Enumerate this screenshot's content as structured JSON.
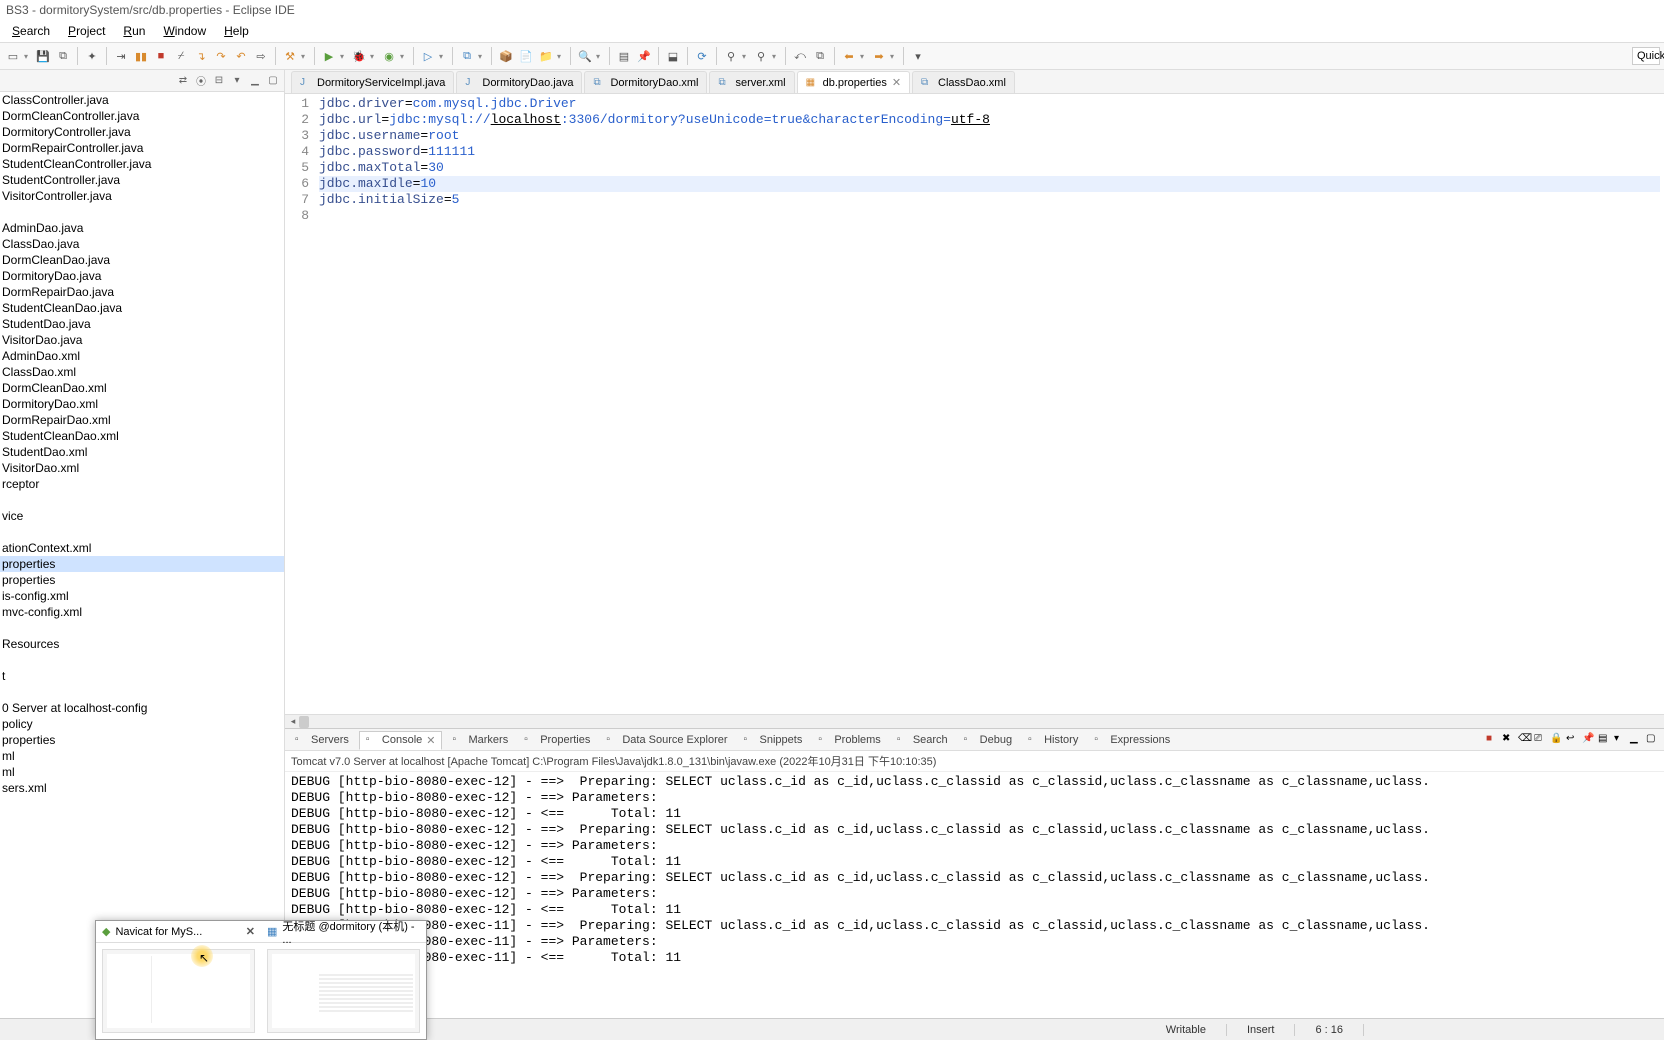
{
  "window": {
    "title": "BS3 - dormitorySystem/src/db.properties - Eclipse IDE"
  },
  "menu": [
    "Search",
    "Project",
    "Run",
    "Window",
    "Help"
  ],
  "quick": "Quick",
  "tree": {
    "items": [
      "ClassController.java",
      "DormCleanController.java",
      "DormitoryController.java",
      "DormRepairController.java",
      "StudentCleanController.java",
      "StudentController.java",
      "VisitorController.java",
      "",
      "AdminDao.java",
      "ClassDao.java",
      "DormCleanDao.java",
      "DormitoryDao.java",
      "DormRepairDao.java",
      "StudentCleanDao.java",
      "StudentDao.java",
      "VisitorDao.java",
      "AdminDao.xml",
      "ClassDao.xml",
      "DormCleanDao.xml",
      "DormitoryDao.xml",
      "DormRepairDao.xml",
      "StudentCleanDao.xml",
      "StudentDao.xml",
      "VisitorDao.xml",
      "rceptor",
      "",
      "vice",
      "",
      "ationContext.xml",
      "properties",
      "properties",
      "is-config.xml",
      "mvc-config.xml",
      "",
      "Resources",
      "",
      "t",
      "",
      "0 Server at localhost-config",
      "policy",
      "properties",
      "ml",
      "ml",
      "sers.xml"
    ],
    "selected": 29
  },
  "tabs": [
    {
      "label": "DormitoryServiceImpl.java",
      "kind": "java"
    },
    {
      "label": "DormitoryDao.java",
      "kind": "java"
    },
    {
      "label": "DormitoryDao.xml",
      "kind": "xml"
    },
    {
      "label": "server.xml",
      "kind": "xml"
    },
    {
      "label": "db.properties",
      "kind": "props",
      "active": true,
      "closeable": true
    },
    {
      "label": "ClassDao.xml",
      "kind": "xml"
    }
  ],
  "editor": {
    "highlight_line": 6,
    "lines": [
      {
        "n": 1,
        "tokens": [
          [
            "kw-key",
            "jdbc.driver"
          ],
          [
            "kw-plain",
            "="
          ],
          [
            "kw-val",
            "com.mysql.jdbc.Driver"
          ]
        ]
      },
      {
        "n": 2,
        "tokens": [
          [
            "kw-key",
            "jdbc.url"
          ],
          [
            "kw-plain",
            "="
          ],
          [
            "kw-val",
            "jdbc:mysql://"
          ],
          [
            "kw-host",
            "localhost"
          ],
          [
            "kw-val",
            ":3306/dormitory?useUnicode=true&characterEncoding="
          ],
          [
            "kw-enc",
            "utf-8"
          ]
        ]
      },
      {
        "n": 3,
        "tokens": [
          [
            "kw-key",
            "jdbc.username"
          ],
          [
            "kw-plain",
            "="
          ],
          [
            "kw-val",
            "root"
          ]
        ]
      },
      {
        "n": 4,
        "tokens": [
          [
            "kw-key",
            "jdbc.password"
          ],
          [
            "kw-plain",
            "="
          ],
          [
            "kw-val",
            "111111"
          ]
        ]
      },
      {
        "n": 5,
        "tokens": [
          [
            "kw-key",
            "jdbc.maxTotal"
          ],
          [
            "kw-plain",
            "="
          ],
          [
            "kw-val",
            "30"
          ]
        ]
      },
      {
        "n": 6,
        "tokens": [
          [
            "kw-key",
            "jdbc.maxIdle"
          ],
          [
            "kw-plain",
            "="
          ],
          [
            "kw-val",
            "10"
          ]
        ]
      },
      {
        "n": 7,
        "tokens": [
          [
            "kw-key",
            "jdbc.initialSize"
          ],
          [
            "kw-plain",
            "="
          ],
          [
            "kw-val",
            "5"
          ]
        ]
      },
      {
        "n": 8,
        "tokens": []
      }
    ]
  },
  "bottom": {
    "tabs": [
      "Servers",
      "Console",
      "Markers",
      "Properties",
      "Data Source Explorer",
      "Snippets",
      "Problems",
      "Search",
      "Debug",
      "History",
      "Expressions"
    ],
    "active": 1,
    "header": "Tomcat v7.0 Server at localhost [Apache Tomcat] C:\\Program Files\\Java\\jdk1.8.0_131\\bin\\javaw.exe (2022年10月31日 下午10:10:35)",
    "lines": [
      "DEBUG [http-bio-8080-exec-12] - ==>  Preparing: SELECT uclass.c_id as c_id,uclass.c_classid as c_classid,uclass.c_classname as c_classname,uclass.",
      "DEBUG [http-bio-8080-exec-12] - ==> Parameters: ",
      "DEBUG [http-bio-8080-exec-12] - <==      Total: 11",
      "DEBUG [http-bio-8080-exec-12] - ==>  Preparing: SELECT uclass.c_id as c_id,uclass.c_classid as c_classid,uclass.c_classname as c_classname,uclass.",
      "DEBUG [http-bio-8080-exec-12] - ==> Parameters: ",
      "DEBUG [http-bio-8080-exec-12] - <==      Total: 11",
      "DEBUG [http-bio-8080-exec-12] - ==>  Preparing: SELECT uclass.c_id as c_id,uclass.c_classid as c_classid,uclass.c_classname as c_classname,uclass.",
      "DEBUG [http-bio-8080-exec-12] - ==> Parameters: ",
      "DEBUG [http-bio-8080-exec-12] - <==      Total: 11",
      "DEBUG [http-bio-8080-exec-11] - ==>  Preparing: SELECT uclass.c_id as c_id,uclass.c_classid as c_classid,uclass.c_classname as c_classname,uclass.",
      "DEBUG [http-bio-8080-exec-11] - ==> Parameters: ",
      "DEBUG [http-bio-8080-exec-11] - <==      Total: 11"
    ]
  },
  "status": {
    "writable": "Writable",
    "insert": "Insert",
    "pos": "6 : 16"
  },
  "taskbar": {
    "items": [
      {
        "title": "Navicat for MyS...",
        "closeable": true
      },
      {
        "title": "无标题 @dormitory (本机) - ..."
      }
    ]
  }
}
